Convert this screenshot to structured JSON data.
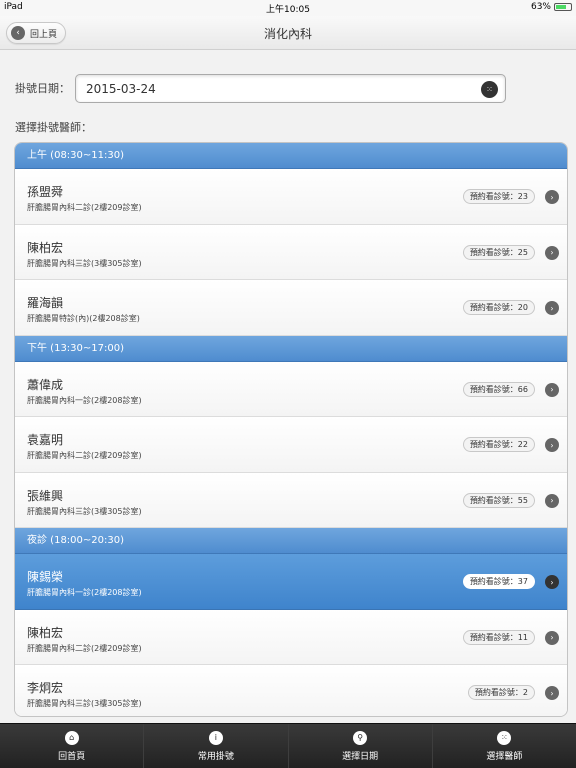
{
  "status": {
    "device": "iPad",
    "time": "上午10:05",
    "battery": "63%"
  },
  "header": {
    "back_label": "回上頁",
    "title": "消化內科"
  },
  "form": {
    "date_label": "掛號日期：",
    "date_value": "2015-03-24",
    "doctor_label": "選擇掛號醫師："
  },
  "sections": [
    {
      "title": "上午 (08:30~11:30)",
      "rows": [
        {
          "name": "孫盟舜",
          "room": "肝膽腸胃內科二診(2樓209診室)",
          "badge": "預約看診號：23",
          "active": false
        },
        {
          "name": "陳柏宏",
          "room": "肝膽腸胃內科三診(3樓305診室)",
          "badge": "預約看診號：25",
          "active": false
        },
        {
          "name": "羅海韻",
          "room": "肝膽腸胃特診(內)(2樓208診室)",
          "badge": "預約看診號：20",
          "active": false
        }
      ]
    },
    {
      "title": "下午 (13:30~17:00)",
      "rows": [
        {
          "name": "蕭偉成",
          "room": "肝膽腸胃內科一診(2樓208診室)",
          "badge": "預約看診號：66",
          "active": false
        },
        {
          "name": "袁嘉明",
          "room": "肝膽腸胃內科二診(2樓209診室)",
          "badge": "預約看診號：22",
          "active": false
        },
        {
          "name": "張維興",
          "room": "肝膽腸胃內科三診(3樓305診室)",
          "badge": "預約看診號：55",
          "active": false
        }
      ]
    },
    {
      "title": "夜診 (18:00~20:30)",
      "rows": [
        {
          "name": "陳錫榮",
          "room": "肝膽腸胃內科一診(2樓208診室)",
          "badge": "預約看診號：37",
          "active": true
        },
        {
          "name": "陳柏宏",
          "room": "肝膽腸胃內科二診(2樓209診室)",
          "badge": "預約看診號：11",
          "active": false
        },
        {
          "name": "李炯宏",
          "room": "肝膽腸胃內科三診(3樓305診室)",
          "badge": "預約看診號：2",
          "active": false
        }
      ]
    }
  ],
  "tabs": [
    {
      "label": "回首頁",
      "icon": "home-icon",
      "glyph": "⌂"
    },
    {
      "label": "常用掛號",
      "icon": "info-icon",
      "glyph": "i"
    },
    {
      "label": "選擇日期",
      "icon": "search-icon",
      "glyph": "⚲"
    },
    {
      "label": "選擇醫師",
      "icon": "grid-icon",
      "glyph": "⁙"
    }
  ]
}
